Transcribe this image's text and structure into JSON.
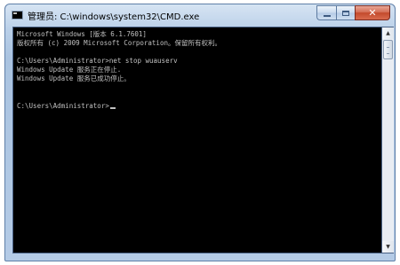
{
  "window": {
    "title": "管理员: C:\\windows\\system32\\CMD.exe",
    "icon": "cmd-icon",
    "controls": {
      "minimize": "minimize-icon",
      "maximize": "maximize-icon",
      "close": "✕"
    }
  },
  "console": {
    "lines": [
      "Microsoft Windows [版本 6.1.7601]",
      "版权所有 (c) 2009 Microsoft Corporation。保留所有权利。",
      "",
      "C:\\Users\\Administrator>net stop wuauserv",
      "Windows Update 服务正在停止.",
      "Windows Update 服务已成功停止。",
      "",
      "",
      "C:\\Users\\Administrator>"
    ]
  },
  "scrollbar": {
    "up": "▲",
    "down": "▼"
  },
  "colors": {
    "console_bg": "#000000",
    "console_fg": "#c0c0c0",
    "title_bar": "#b9cfe8",
    "close_button": "#c44a2c"
  }
}
